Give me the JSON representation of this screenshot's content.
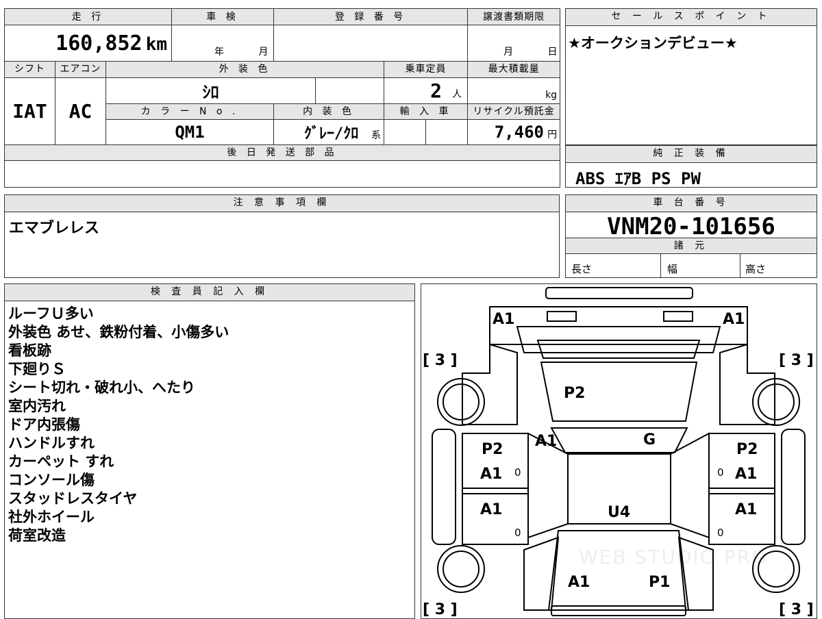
{
  "vehicle": {
    "header_mileage": "走 行",
    "mileage_value": "160,852",
    "mileage_unit": "km",
    "header_inspection": "車 検",
    "inspection_year_unit": "年",
    "inspection_month_unit": "月",
    "header_registration": "登 録 番 号",
    "registration_value": "",
    "header_transfer": "譲渡書類期限",
    "transfer_month_unit": "月",
    "transfer_day_unit": "日",
    "header_shift": "シフト",
    "shift_value": "IAT",
    "header_aircon": "エアコン",
    "aircon_value": "AC",
    "header_exterior": "外 装 色",
    "exterior_value": "ｼﾛ",
    "header_capacity": "乗車定員",
    "capacity_value": "2",
    "capacity_unit": "人",
    "header_maxload": "最大積載量",
    "maxload_unit": "kg",
    "header_color_no": "カ ラ ー N o .",
    "color_no_value": "QM1",
    "header_interior": "内 装 色",
    "interior_value": "ｸﾞﾚｰ/ｸﾛ",
    "interior_suffix": "系",
    "header_import": "輸 入 車",
    "header_recycle": "リサイクル預託金",
    "recycle_value": "7,460",
    "recycle_unit": "円",
    "header_later_parts": "後 日 発 送 部 品"
  },
  "sales_point": {
    "header": "セ ー ル ス ポ イ ン ト",
    "text": "★オークションデビュー★"
  },
  "standard_equipment": {
    "header": "純 正 装 備",
    "text": "ABS ｴｱB PS PW"
  },
  "caution": {
    "header": "注 意 事 項 欄",
    "text": "エマブレレス"
  },
  "chassis": {
    "header": "車 台 番 号",
    "value": "VNM20-101656",
    "specs_header": "諸 元",
    "length_label": "長さ",
    "width_label": "幅",
    "height_label": "高さ"
  },
  "inspector": {
    "header": "検 査 員 記 入 欄",
    "notes": [
      "ルーフＵ多い",
      "外装色 あせ、鉄粉付着、小傷多い",
      "看板跡",
      "下廻りＳ",
      "シート切れ・破れ小、へたり",
      "室内汚れ",
      "ドア内張傷",
      "ハンドルすれ",
      "カーペット すれ",
      "コンソール傷",
      "スタッドレスタイヤ",
      "社外ホイール",
      "荷室改造"
    ]
  },
  "diagram": {
    "marks": {
      "front_left": "A1",
      "front_right": "A1",
      "tire_fl": "[ 3 ]",
      "tire_fr": "[ 3 ]",
      "tire_rl": "[ 3 ]",
      "tire_rr": "[ 3 ]",
      "bonnet": "P2",
      "windshield_left": "A1",
      "windshield_right": "G",
      "left_front_door_1": "P2",
      "left_front_door_2": "A1",
      "right_front_door_1": "P2",
      "right_front_door_2": "A1",
      "left_rear_door": "A1",
      "right_rear_door": "A1",
      "roof": "U4",
      "rear_left": "A1",
      "rear_right": "P1",
      "door_zero_1": "0",
      "door_zero_2": "0",
      "door_zero_3": "0",
      "door_zero_4": "0"
    },
    "watermark": "WEB STUDIO PRO"
  }
}
